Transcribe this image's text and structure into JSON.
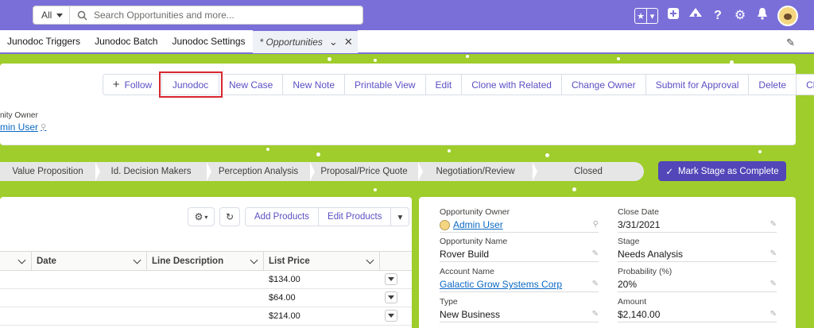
{
  "header": {
    "search_scope": "All",
    "search_placeholder": "Search Opportunities and more...",
    "icons": [
      "favorites-star-icon",
      "favorites-menu-icon",
      "add-icon",
      "trailhead-icon",
      "help-icon",
      "setup-gear-icon",
      "notifications-bell-icon"
    ]
  },
  "tabs": [
    {
      "label": "Junodoc Triggers"
    },
    {
      "label": "Junodoc Batch"
    },
    {
      "label": "Junodoc Settings"
    },
    {
      "label": "* Opportunities",
      "active": true
    }
  ],
  "actions": {
    "follow": "Follow",
    "junodoc": "Junodoc",
    "new_case": "New Case",
    "new_note": "New Note",
    "printable_view": "Printable View",
    "edit": "Edit",
    "clone_related": "Clone with Related",
    "change_owner": "Change Owner",
    "submit_approval": "Submit for Approval",
    "delete": "Delete",
    "clone": "Clone"
  },
  "record_header": {
    "owner_label": "nity Owner",
    "owner_value": "min User"
  },
  "path": {
    "stages": [
      "Value Proposition",
      "Id. Decision Makers",
      "Perception Analysis",
      "Proposal/Price Quote",
      "Negotiation/Review",
      "Closed"
    ],
    "mark_complete": "Mark Stage as Complete"
  },
  "products": {
    "add_products": "Add Products",
    "edit_products": "Edit Products",
    "columns": {
      "date": "Date",
      "line_description": "Line Description",
      "list_price": "List Price"
    },
    "rows": [
      {
        "list_price": "$134.00"
      },
      {
        "list_price": "$64.00"
      },
      {
        "list_price": "$214.00"
      }
    ]
  },
  "details": {
    "opportunity_owner": {
      "label": "Opportunity Owner",
      "value": "Admin User"
    },
    "opportunity_name": {
      "label": "Opportunity Name",
      "value": "Rover Build"
    },
    "account_name": {
      "label": "Account Name",
      "value": "Galactic Grow Systems Corp"
    },
    "type": {
      "label": "Type",
      "value": "New Business"
    },
    "close_date": {
      "label": "Close Date",
      "value": "3/31/2021"
    },
    "stage": {
      "label": "Stage",
      "value": "Needs Analysis"
    },
    "probability": {
      "label": "Probability (%)",
      "value": "20%"
    },
    "amount": {
      "label": "Amount",
      "value": "$2,140.00"
    }
  },
  "colors": {
    "header_bg": "#7a6fd8",
    "page_bg": "#9fcd2b",
    "brand_button": "#5246b8",
    "link": "#0b68c4",
    "highlight": "#d8262e"
  }
}
